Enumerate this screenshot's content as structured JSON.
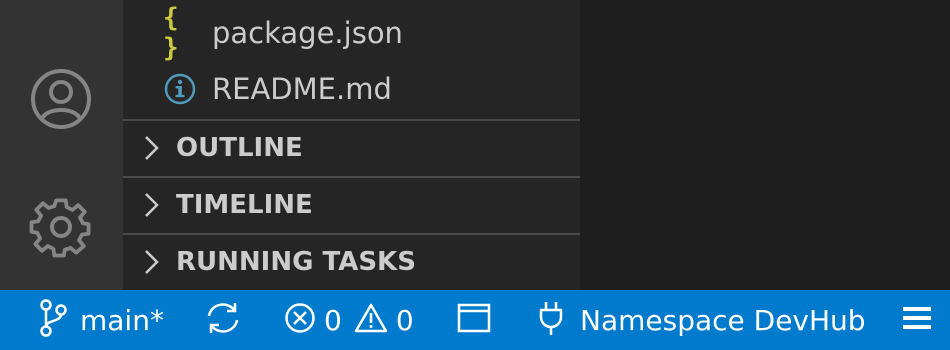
{
  "sidebar": {
    "files": [
      {
        "name": "package.json",
        "icon": "json-braces-icon",
        "icon_glyph": "{ }",
        "icon_color": "#cbcb41"
      },
      {
        "name": "README.md",
        "icon": "info-icon",
        "icon_color": "#519aba"
      }
    ],
    "sections": [
      {
        "label": "OUTLINE",
        "expanded": false
      },
      {
        "label": "TIMELINE",
        "expanded": false
      },
      {
        "label": "RUNNING TASKS",
        "expanded": false
      }
    ]
  },
  "activity_bar": {
    "items": [
      {
        "name": "accounts",
        "icon": "account-icon"
      },
      {
        "name": "manage",
        "icon": "gear-icon"
      }
    ]
  },
  "status_bar": {
    "branch": "main*",
    "errors": "0",
    "warnings": "0",
    "remote": "Namespace DevHub",
    "background": "#007acc"
  },
  "colors": {
    "activity_bar": "#333333",
    "sidebar": "#252526",
    "editor": "#1e1e1e",
    "text": "#cccccc"
  }
}
